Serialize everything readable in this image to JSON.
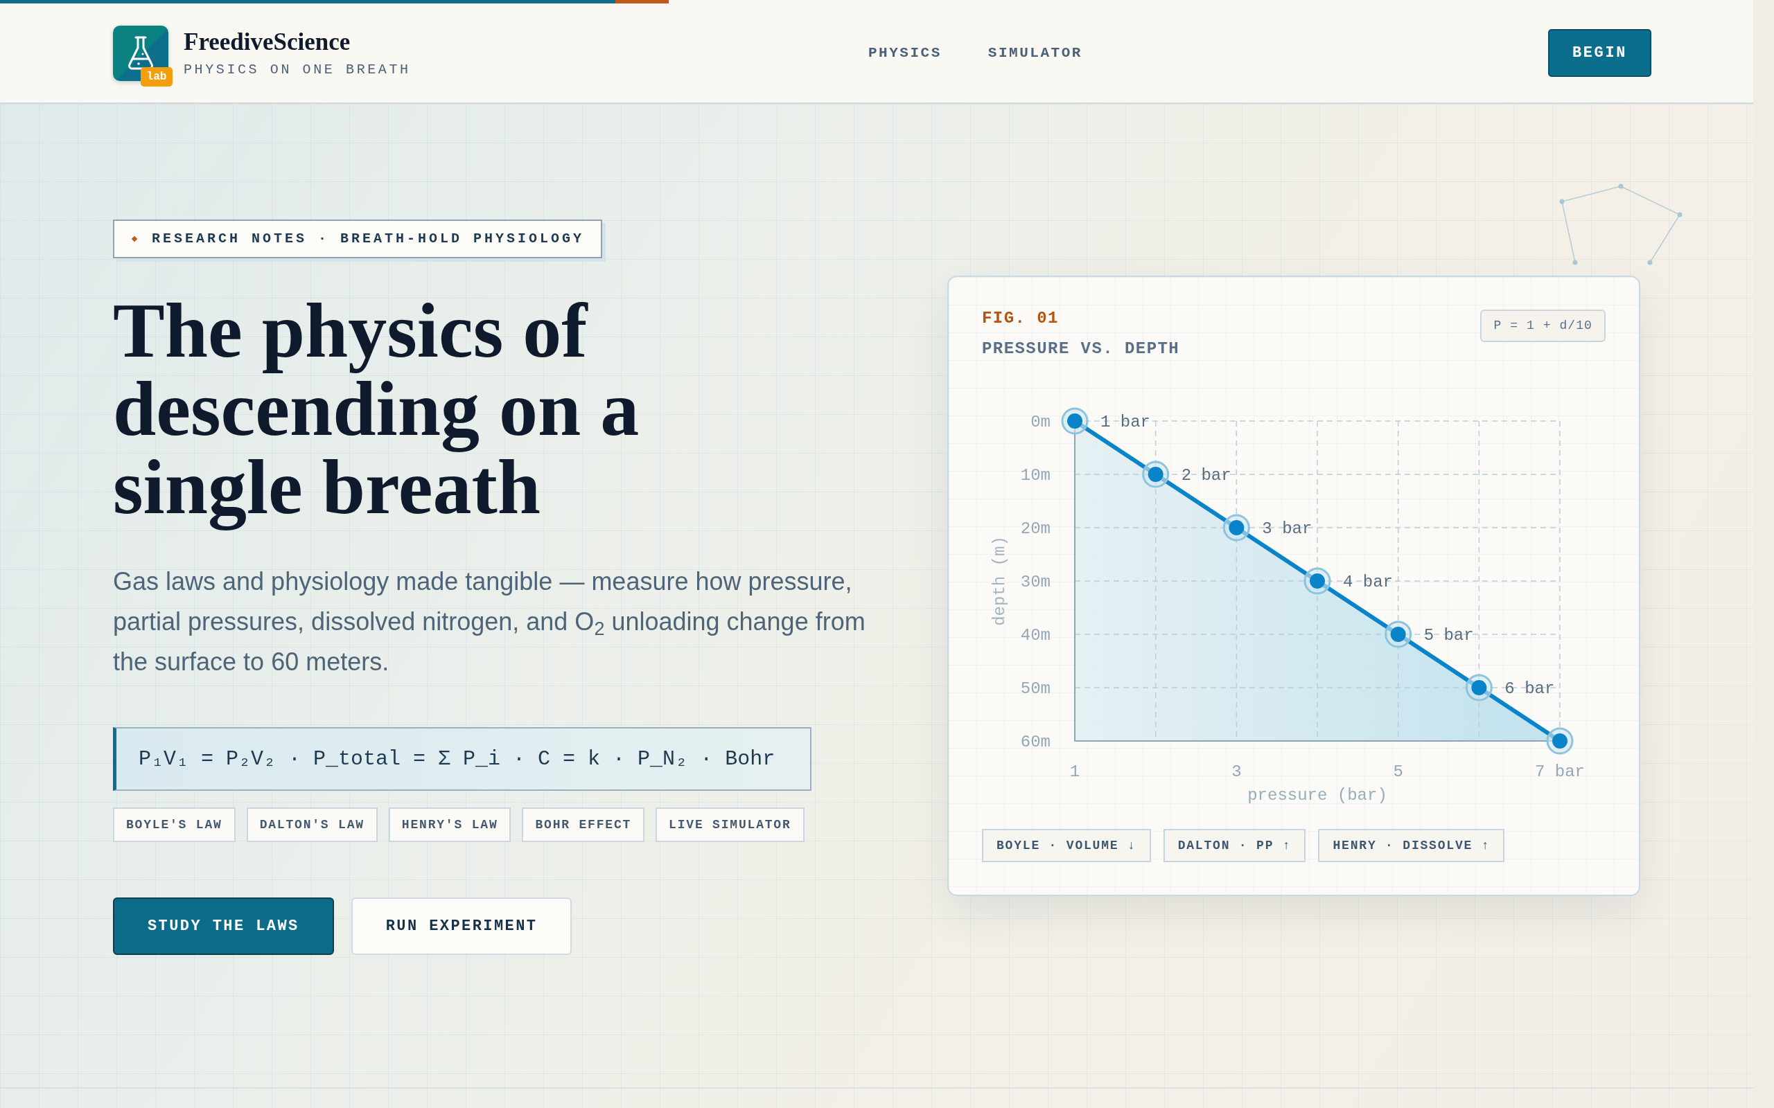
{
  "header": {
    "brand": {
      "name": "FreediveScience",
      "tagline": "PHYSICS ON ONE BREATH",
      "badge": "lab"
    },
    "nav": [
      {
        "label": "PHYSICS"
      },
      {
        "label": "SIMULATOR"
      }
    ],
    "cta": {
      "label": "BEGIN"
    }
  },
  "hero": {
    "eyebrow": "RESEARCH NOTES · BREATH-HOLD PHYSIOLOGY",
    "title": "The physics of descending on a single breath",
    "lead": "Gas laws and physiology made tangible — measure how pressure, partial pressures, dissolved nitrogen, and O$_{2}$ unloading change from the surface to 60 meters.",
    "formula": "P₁V₁ = P₂V₂ · P_total = Σ P_i · C = k · P_N₂ · Bohr",
    "tags": [
      {
        "label": "BOYLE'S LAW"
      },
      {
        "label": "DALTON'S LAW"
      },
      {
        "label": "HENRY'S LAW"
      },
      {
        "label": "BOHR EFFECT"
      },
      {
        "label": "LIVE SIMULATOR"
      }
    ],
    "actions": [
      {
        "label": "STUDY THE LAWS",
        "kind": "primary"
      },
      {
        "label": "RUN EXPERIMENT",
        "kind": "secondary"
      }
    ]
  },
  "figure": {
    "label": "FIG. 01",
    "formula": "P = 1 + d/10",
    "chart_data": {
      "type": "line",
      "title": "PRESSURE VS. DEPTH",
      "xlabel": "pressure (bar)",
      "ylabel": "depth (m)",
      "x": [
        1,
        2,
        3,
        4,
        5,
        6,
        7
      ],
      "series": [
        {
          "color": "#0a84c8",
          "marker": "o",
          "values": [
            0,
            10,
            20,
            30,
            40,
            50,
            60
          ]
        }
      ],
      "xlim": [
        1,
        7
      ],
      "ylim": [
        60,
        0
      ],
      "xticks": [
        1,
        3,
        5,
        {
          "value": 7,
          "label": "7 bar"
        }
      ],
      "yticks": [
        {
          "value": 0,
          "label": "0m"
        },
        {
          "value": 10,
          "label": "10m"
        },
        {
          "value": 20,
          "label": "20m"
        },
        {
          "value": 30,
          "label": "30m"
        },
        {
          "value": 40,
          "label": "40m"
        },
        {
          "value": 50,
          "label": "50m"
        },
        {
          "value": 60,
          "label": "60m"
        }
      ],
      "grid": true,
      "value_labels": [
        "1 bar",
        "2 bar",
        "3 bar",
        "4 bar",
        "5 bar",
        "6 bar"
      ]
    },
    "legend": [
      {
        "label": "BOYLE · VOLUME ↓"
      },
      {
        "label": "DALTON · PP ↑"
      },
      {
        "label": "HENRY · DISSOLVE ↑"
      }
    ]
  }
}
